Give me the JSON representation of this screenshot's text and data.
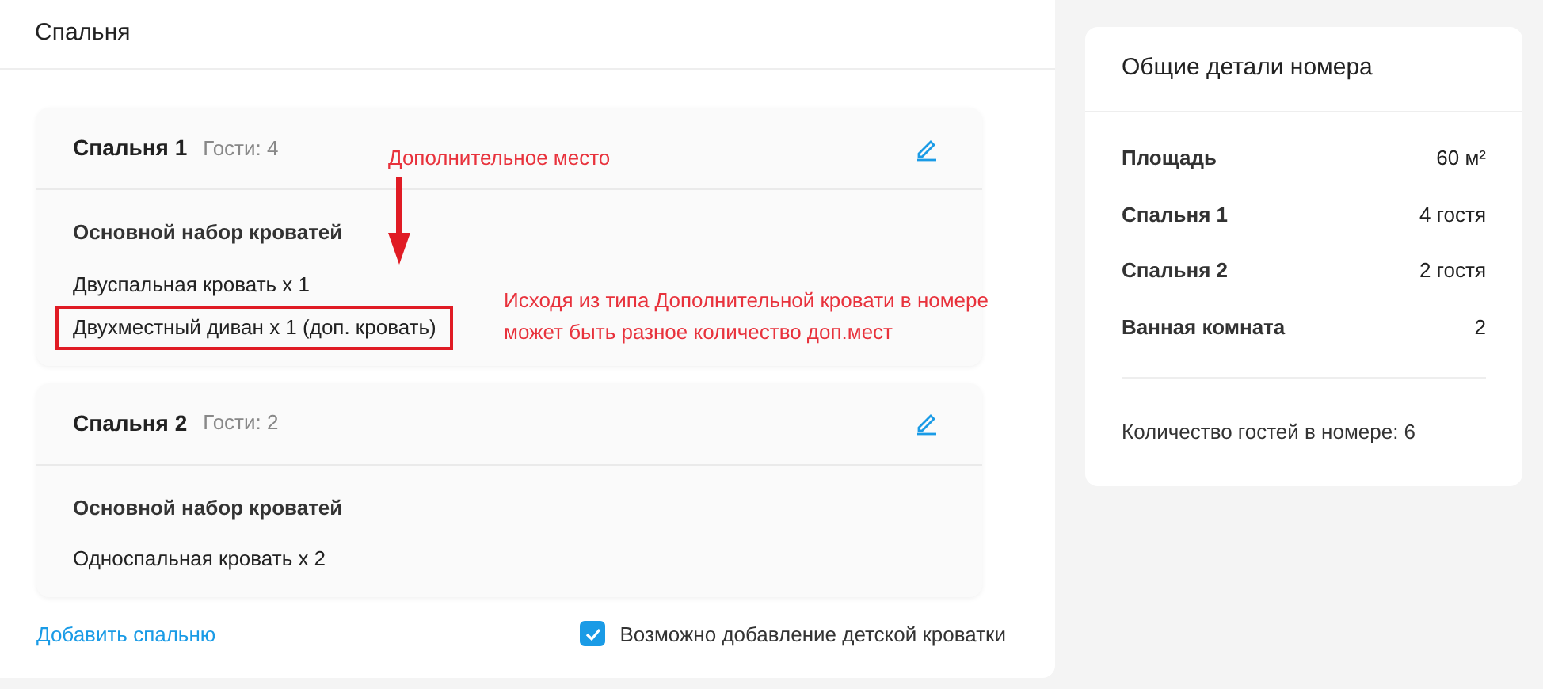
{
  "section_title": "Спальня",
  "bedrooms": [
    {
      "name": "Спальня 1",
      "guests": "Гости: 4",
      "set_title": "Основной набор кроватей",
      "beds": [
        {
          "text": "Двуспальная кровать х 1",
          "highlighted": false
        },
        {
          "text": "Двухместный диван х 1 (доп. кровать)",
          "highlighted": true
        }
      ]
    },
    {
      "name": "Спальня 2",
      "guests": "Гости: 2",
      "set_title": "Основной набор кроватей",
      "beds": [
        {
          "text": "Односпальная кровать х 2",
          "highlighted": false
        }
      ]
    }
  ],
  "add_bedroom": "Добавить спальню",
  "crib_option": {
    "label": "Возможно добавление детской кроватки",
    "checked": true
  },
  "annotations": {
    "arrow_label": "Дополнительное место",
    "note": "Исходя из типа Дополнительной кровати в номере может быть разное количество доп.мест"
  },
  "summary": {
    "title": "Общие детали номера",
    "rows": [
      {
        "label": "Площадь",
        "value": "60 м²"
      },
      {
        "label": "Спальня 1",
        "value": "4 гостя"
      },
      {
        "label": "Спальня 2",
        "value": "2 гостя"
      },
      {
        "label": "Ванная комната",
        "value": "2"
      }
    ],
    "total": "Количество гостей в номере: 6"
  }
}
